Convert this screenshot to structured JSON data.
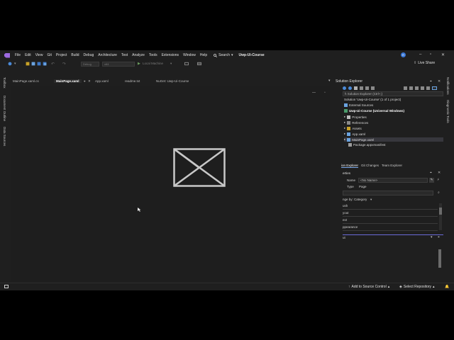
{
  "menubar": {
    "items": [
      "File",
      "Edit",
      "View",
      "Git",
      "Project",
      "Build",
      "Debug",
      "Architecture",
      "Test",
      "Analyze",
      "Tools",
      "Extensions",
      "Window",
      "Help"
    ],
    "search_label": "Search",
    "solution_name": "Uwp-Ui-Course",
    "avatar_initial": "R"
  },
  "toolbar": {
    "config_value": "Debug",
    "platform_value": "x64",
    "run_target": "Local Machine",
    "live_share": "Live Share"
  },
  "left_strip": [
    "Toolbox",
    "Document Outline",
    "Data Sources"
  ],
  "right_strip": [
    "Notifications",
    "Diagnostic Tools"
  ],
  "doc_tabs": [
    "MainPage.xaml.cs",
    "MainPage.xaml",
    "App.xaml",
    "readme.txt",
    "NuGet: Uwp-Ui-Course"
  ],
  "solution_explorer": {
    "title": "Solution Explorer",
    "search_placeholder": "h Solution Explorer (Ctrl+;)",
    "solution_line": "Solution 'Uwp-Ui-Course' (1 of 1 project)",
    "items": [
      {
        "label": "External Sources",
        "bold": false
      },
      {
        "label": "Uwp-Ui-Course (Universal Windows)",
        "bold": true
      },
      {
        "label": "Properties",
        "bold": false
      },
      {
        "label": "References",
        "bold": false
      },
      {
        "label": "Assets",
        "bold": false
      },
      {
        "label": "App.xaml",
        "bold": false
      },
      {
        "label": "MainPage.xaml",
        "bold": false
      },
      {
        "label": "Package.appxmanifest",
        "bold": false
      }
    ],
    "tabs": [
      "ion Explorer",
      "Git Changes",
      "Team Explorer"
    ]
  },
  "properties": {
    "title": "erties",
    "name_label": "Name",
    "name_value": "<No Name>",
    "type_label": "Type",
    "type_value": "Page",
    "arrange_label": "nge by: Category",
    "categories": [
      "ush",
      "yout",
      "ext",
      "ppearance"
    ],
    "lower_label": "ut"
  },
  "statusbar": {
    "add_source": "Add to Source Control",
    "select_repo": "Select Repository"
  },
  "colors": {
    "accent": "#9d6ae0",
    "background": "#1f1f1f",
    "designer": "#1e1e1e"
  }
}
